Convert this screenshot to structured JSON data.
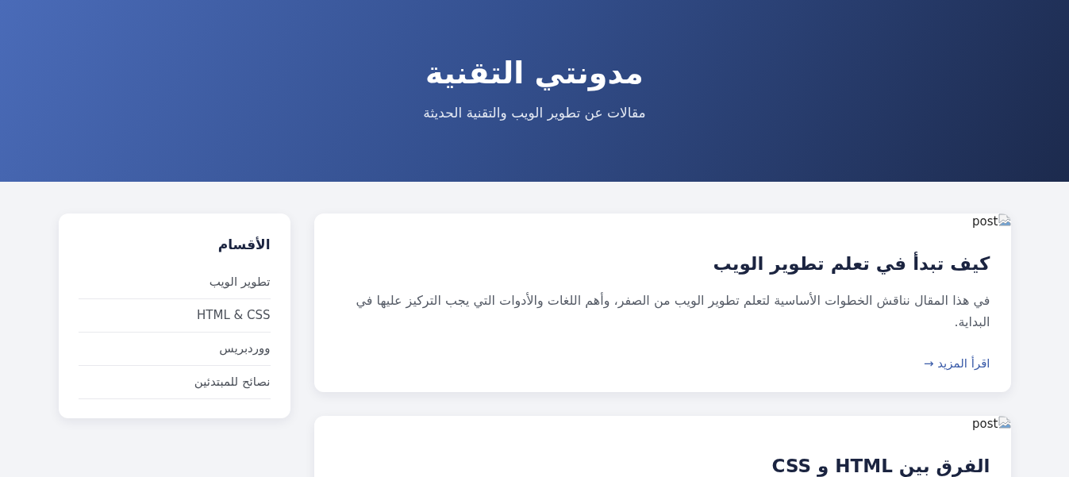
{
  "header": {
    "title": "مدونتي التقنية",
    "subtitle": "مقالات عن تطوير الويب والتقنية الحديثة"
  },
  "posts": [
    {
      "image_alt": "post",
      "title": "كيف تبدأ في تعلم تطوير الويب",
      "excerpt": "في هذا المقال نناقش الخطوات الأساسية لتعلم تطوير الويب من الصفر، وأهم اللغات والأدوات التي يجب التركيز عليها في البداية.",
      "link": "اقرأ المزيد →"
    },
    {
      "image_alt": "post",
      "title": "الفرق بين HTML و CSS"
    }
  ],
  "sidebar": {
    "title": "الأقسام",
    "items": [
      "تطوير الويب",
      "HTML & CSS",
      "ووردبريس",
      "نصائح للمبتدئين"
    ]
  }
}
